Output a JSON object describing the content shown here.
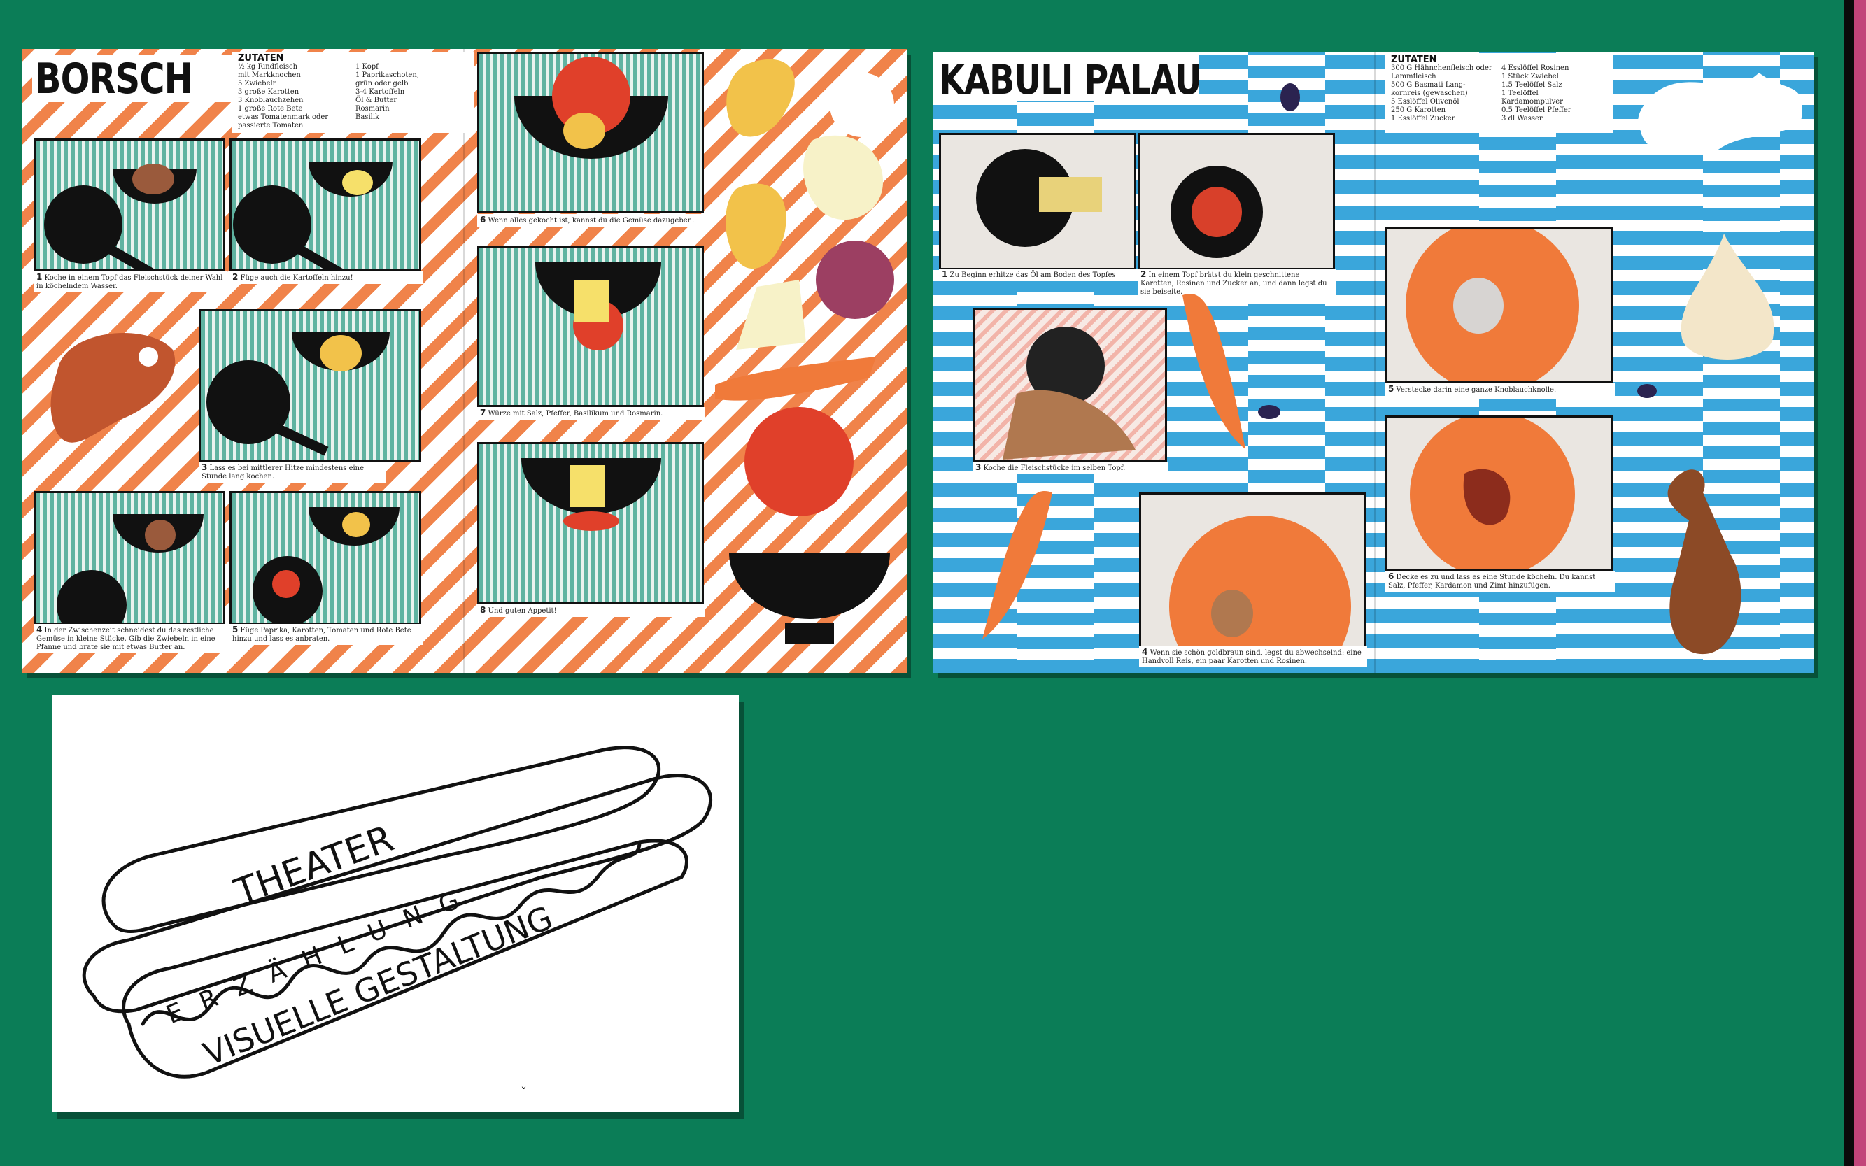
{
  "colors": {
    "background": "#0b7d57",
    "borsch_stripe": "#f0834a",
    "kabuli_stripe": "#3aa6db",
    "edge_strip": "#c2457a"
  },
  "borsch": {
    "title": "BORSCH",
    "ingredients": {
      "heading": "ZUTATEN",
      "col1": "½ kg Rindfleisch\nmit Markknochen\n5 Zwiebeln\n3 große Karotten\n3 Knoblauchzehen\n1 große Rote Bete\netwas Tomatenmark oder\npassierte Tomaten",
      "col2": "1 Kopf\n1 Paprikaschoten,\ngrün oder gelb\n3-4 Kartoffeln\nÖl & Butter\nRosmarin\nBasilik"
    },
    "steps": [
      {
        "num": "1",
        "text": "Koche in einem Topf das Fleischstück deiner Wahl in köchelndem Wasser."
      },
      {
        "num": "2",
        "text": "Füge auch die Kartoffeln hinzu!"
      },
      {
        "num": "3",
        "text": "Lass es bei mittlerer Hitze mindestens eine Stunde lang kochen."
      },
      {
        "num": "4",
        "text": "In der Zwischenzeit schneidest du das restliche Gemüse in kleine Stücke. Gib die Zwiebeln in eine Pfanne und brate sie mit etwas Butter an."
      },
      {
        "num": "5",
        "text": "Füge Paprika, Karotten, Tomaten und Rote Bete hinzu und lass es anbraten."
      },
      {
        "num": "6",
        "text": "Wenn alles gekocht ist, kannst du die Gemüse dazugeben."
      },
      {
        "num": "7",
        "text": "Würze mit Salz, Pfeffer, Basilikum und Rosmarin."
      },
      {
        "num": "8",
        "text": "Und guten Appetit!"
      }
    ]
  },
  "kabuli": {
    "title": "KABULI PALAU",
    "ingredients": {
      "heading": "ZUTATEN",
      "col1": "300 G Hähnchenfleisch oder\nLammfleisch\n500 G Basmati Lang-\nkornreis (gewaschen)\n5 Esslöffel Olivenöl\n250 G Karotten\n1 Esslöffel Zucker",
      "col2": "4 Esslöffel Rosinen\n1 Stück Zwiebel\n1.5 Teelöffel Salz\n1 Teelöffel\nKardamompulver\n0.5 Teelöffel Pfeffer\n3 dl Wasser"
    },
    "steps": [
      {
        "num": "1",
        "text": "Zu Beginn erhitze das Öl am Boden des Topfes"
      },
      {
        "num": "2",
        "text": "In einem Topf brätst du klein geschnittene Karotten, Rosinen und Zucker an, und dann legst du sie beiseite."
      },
      {
        "num": "3",
        "text": "Koche die Fleischstücke im selben Topf."
      },
      {
        "num": "4",
        "text": "Wenn sie schön goldbraun sind, legst du abwechselnd: eine Handvoll Reis, ein paar Karotten und Rosinen."
      },
      {
        "num": "5",
        "text": "Verstecke darin eine ganze Knoblauchknolle."
      },
      {
        "num": "6",
        "text": "Decke es zu und lass es eine Stunde köcheln. Du kannst Salz, Pfeffer, Kardamon und Zimt hinzufügen."
      }
    ]
  },
  "logo": {
    "word1": "THEATER",
    "word2": "ERZÄHLUNG",
    "word3": "VISUELLE GESTALTUNG"
  }
}
